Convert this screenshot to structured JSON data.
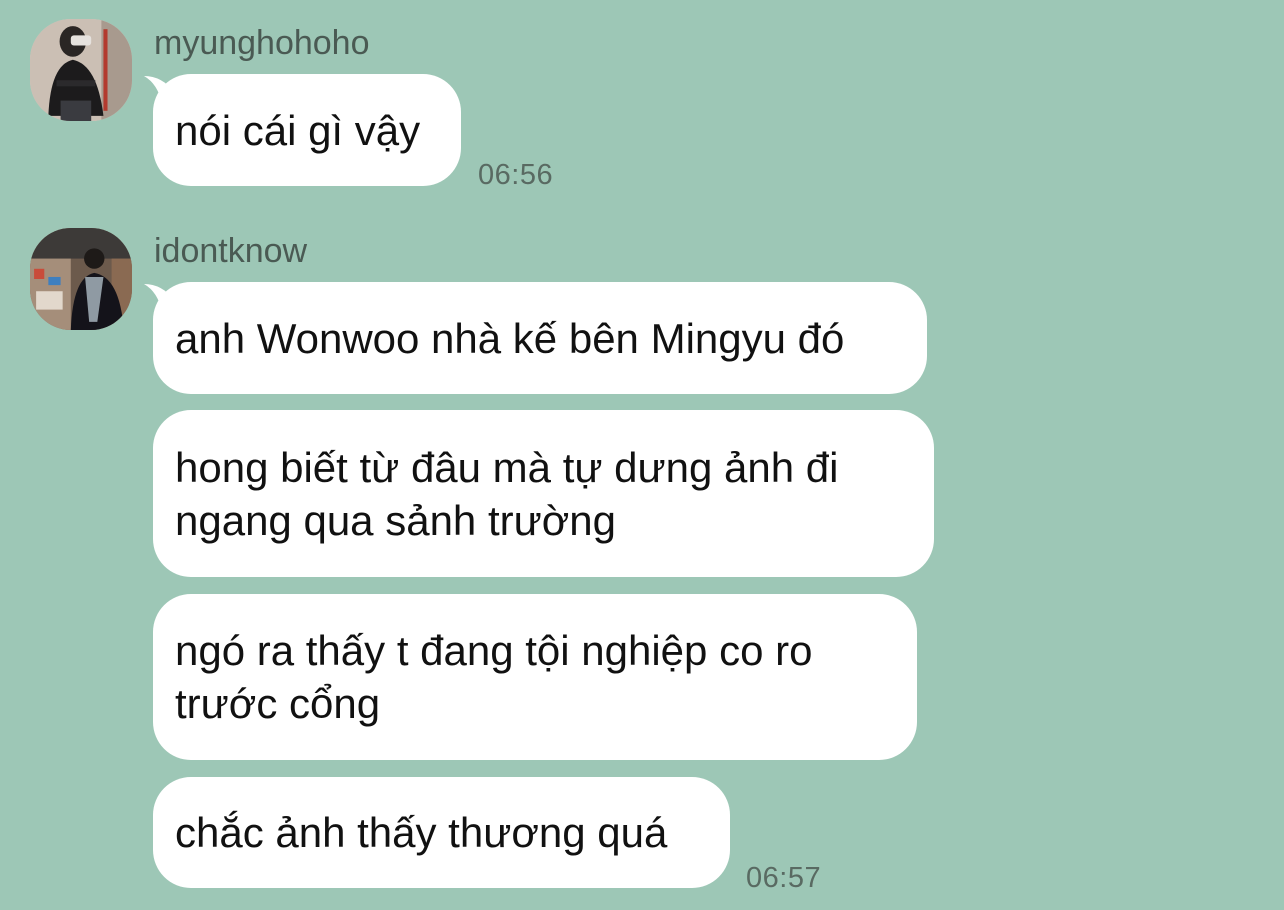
{
  "conversation": {
    "groups": [
      {
        "sender": "myunghohoho",
        "avatar_icon": "profile-photo-icon",
        "messages": [
          "nói cái gì vậy"
        ],
        "time": "06:56"
      },
      {
        "sender": "idontknow",
        "avatar_icon": "profile-photo-icon",
        "messages": [
          "anh Wonwoo nhà kế bên Mingyu đó",
          "hong biết từ đâu mà tự dưng ảnh đi\nngang qua sảnh trường",
          "ngó ra thấy t đang tội nghiệp co ro\ntrước cổng",
          "chắc ảnh thấy thương quá"
        ],
        "time": "06:57"
      }
    ]
  },
  "colors": {
    "background": "#9dc7b6",
    "bubble": "#ffffff",
    "text": "#111111",
    "meta_text": "#4a5a53"
  }
}
